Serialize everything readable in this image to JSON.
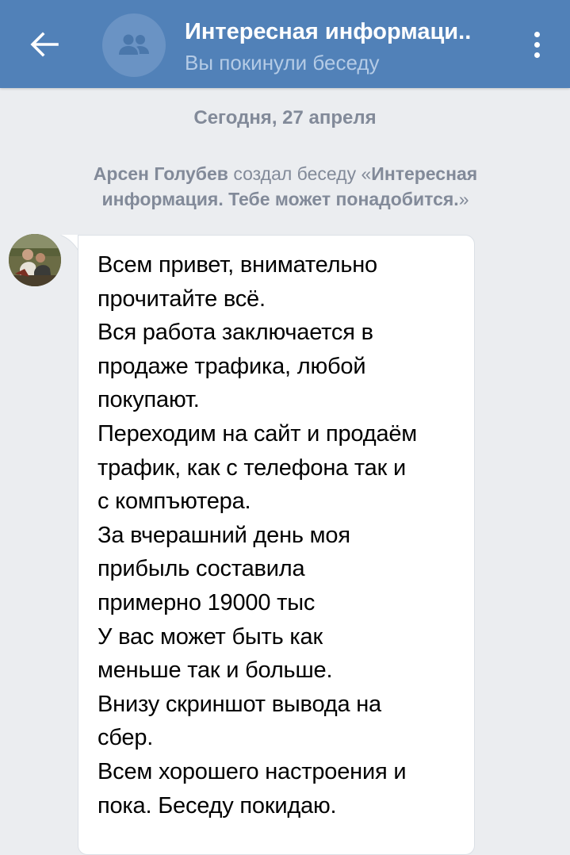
{
  "header": {
    "back_icon": "arrow-left-icon",
    "avatar_icon": "group-icon",
    "title": "Интересная информаци..",
    "subtitle": "Вы покинули беседу",
    "menu_icon": "more-vertical-icon",
    "background_color": "#5181b8"
  },
  "chat": {
    "date_separator": "Сегодня, 27 апреля",
    "service_message": {
      "author": "Арсен Голубев",
      "action": " создал беседу «",
      "chat_name": "Интересная информация. Тебе может понадобится.",
      "closing": "»"
    },
    "message": {
      "text": "Всем привет, внимательно\nпрочитайте всё.\nВся работа заключается в\nпродаже трафика, любой\nпокупают.\nПереходим на сайт и продаём\nтрафик, как с телефона так и\nс компъютера.\nЗа вчерашний день моя\nприбыль составила\nпримерно 19000 тыс\nУ вас может быть как\nменьше так и больше.\nВнизу скриншот вывода на\nсбер.\nВсем хорошего настроения и\nпока. Беседу покидаю."
    }
  }
}
